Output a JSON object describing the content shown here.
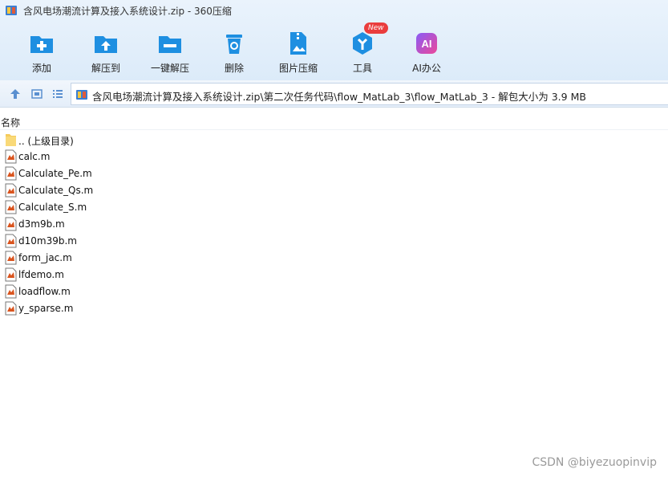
{
  "window": {
    "title": "含风电场潮流计算及接入系统设计.zip - 360压缩"
  },
  "toolbar": {
    "items": [
      {
        "label": "添加",
        "icon": "add-icon"
      },
      {
        "label": "解压到",
        "icon": "extract-to-icon"
      },
      {
        "label": "一键解压",
        "icon": "one-click-extract-icon"
      },
      {
        "label": "删除",
        "icon": "delete-icon"
      },
      {
        "label": "图片压缩",
        "icon": "image-compress-icon"
      },
      {
        "label": "工具",
        "icon": "tools-icon",
        "badge": "New"
      },
      {
        "label": "AI办公",
        "icon": "ai-office-icon",
        "icon_text": "AI"
      }
    ]
  },
  "address": {
    "path": "含风电场潮流计算及接入系统设计.zip\\第二次任务代码\\flow_MatLab_3\\flow_MatLab_3 - 解包大小为 3.9 MB"
  },
  "columns": {
    "name": "名称"
  },
  "files": [
    {
      "name": ".. (上级目录)",
      "type": "folder"
    },
    {
      "name": "calc.m",
      "type": "m"
    },
    {
      "name": "Calculate_Pe.m",
      "type": "m"
    },
    {
      "name": "Calculate_Qs.m",
      "type": "m"
    },
    {
      "name": "Calculate_S.m",
      "type": "m"
    },
    {
      "name": "d3m9b.m",
      "type": "m"
    },
    {
      "name": "d10m39b.m",
      "type": "m"
    },
    {
      "name": "form_jac.m",
      "type": "m"
    },
    {
      "name": "lfdemo.m",
      "type": "m"
    },
    {
      "name": "loadflow.m",
      "type": "m"
    },
    {
      "name": "y_sparse.m",
      "type": "m"
    }
  ],
  "watermark": "CSDN @biyezuopinvip",
  "colors": {
    "accent": "#1e8fe1",
    "badge": "#ea3d3d",
    "ai_gradient_start": "#8a5cf6",
    "ai_gradient_end": "#ec4899"
  }
}
